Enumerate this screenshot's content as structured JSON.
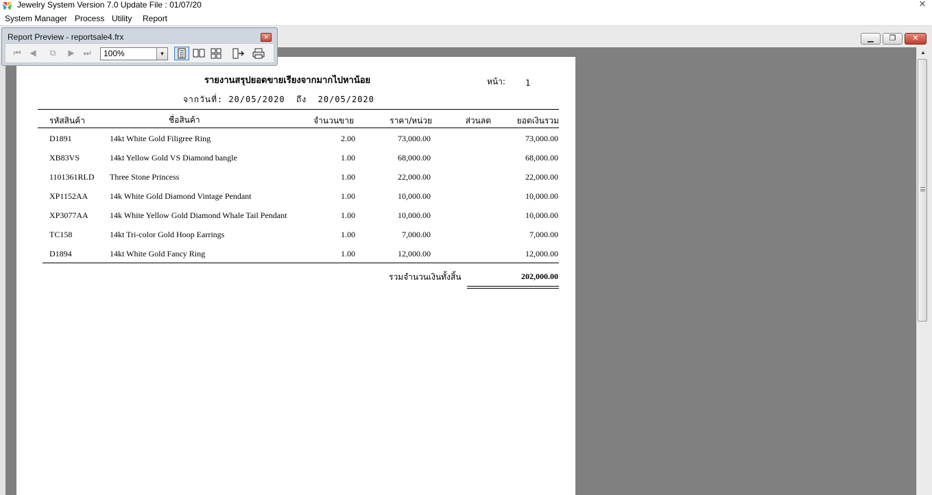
{
  "window": {
    "title": "Jewelry System Version 7.0 Update File : 01/07/20"
  },
  "menu": [
    "System Manager",
    "Process",
    "Utility",
    "Report"
  ],
  "preview": {
    "title": "Report Preview - reportsale4.frx",
    "zoom": "100%"
  },
  "report": {
    "title": "รายงานสรุปยอดขายเรียงจากมากไปหาน้อย",
    "page_label": "หน้า:",
    "page_number": "1",
    "date_range": "จากวันที่: 20/05/2020  ถึง  20/05/2020",
    "columns": {
      "code": "รหัสสินค้า",
      "name": "ชื่อสินค้า",
      "qty": "จำนวนขาย",
      "price": "ราคา/หน่วย",
      "discount": "ส่วนลด",
      "total": "ยอดเงินรวม"
    },
    "rows": [
      {
        "code": "D1891",
        "name": "14kt White Gold Filigree Ring",
        "qty": "2.00",
        "price": "73,000.00",
        "total": "73,000.00"
      },
      {
        "code": "XB83VS",
        "name": "14kt Yellow Gold VS Diamond bangle",
        "qty": "1.00",
        "price": "68,000.00",
        "total": "68,000.00"
      },
      {
        "code": "1101361RLD",
        "name": "Three Stone Princess",
        "qty": "1.00",
        "price": "22,000.00",
        "total": "22,000.00"
      },
      {
        "code": "XP1152AA",
        "name": "14k White Gold Diamond Vintage Pendant",
        "qty": "1.00",
        "price": "10,000.00",
        "total": "10,000.00"
      },
      {
        "code": "XP3077AA",
        "name": "14k White Yellow Gold Diamond Whale Tail Pendant",
        "qty": "1.00",
        "price": "10,000.00",
        "total": "10,000.00"
      },
      {
        "code": "TC158",
        "name": "14kt Tri-color Gold Hoop Earrings",
        "qty": "1.00",
        "price": "7,000.00",
        "total": "7,000.00"
      },
      {
        "code": "D1894",
        "name": "14kt White Gold Fancy Ring",
        "qty": "1.00",
        "price": "12,000.00",
        "total": "12,000.00"
      }
    ],
    "grand_total_label": "รวมจำนวนเงินทั้งสิ้น",
    "grand_total": "202,000.00"
  }
}
